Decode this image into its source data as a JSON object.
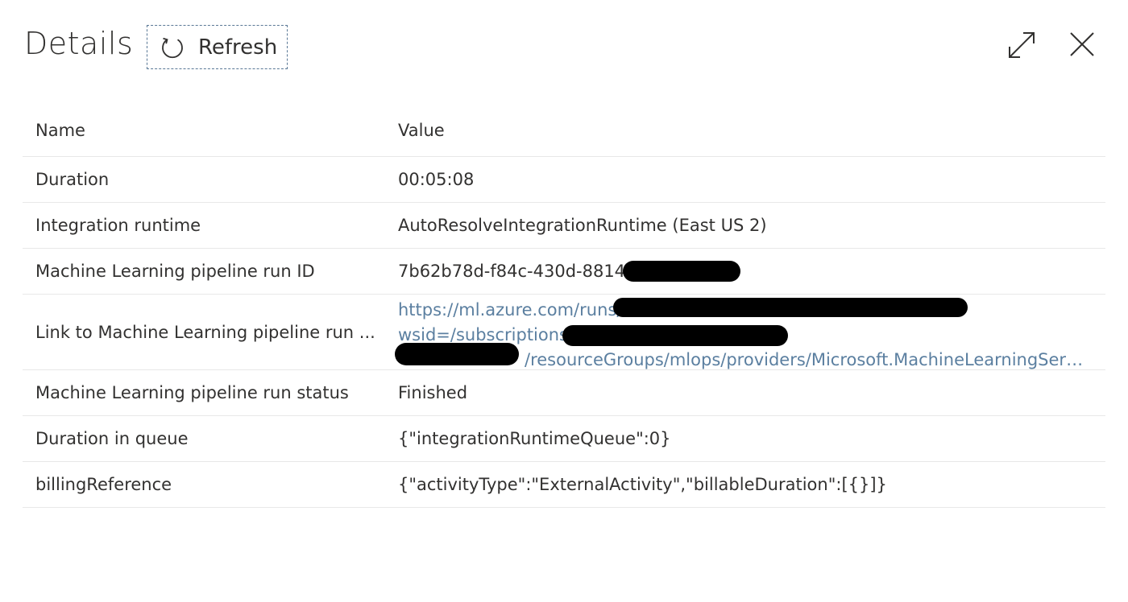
{
  "header": {
    "title": "Details",
    "refresh_label": "Refresh"
  },
  "table": {
    "columns": [
      "Name",
      "Value"
    ],
    "rows": [
      {
        "name": "Duration",
        "value": "00:05:08"
      },
      {
        "name": "Integration runtime",
        "value": "AutoResolveIntegrationRuntime (East US 2)"
      },
      {
        "name": "Machine Learning pipeline run ID",
        "value": "7b62b78d-f84c-430d-8814-"
      },
      {
        "name": "Link to Machine Learning pipeline run ...",
        "link_lines": [
          "https://ml.azure.com/runs/",
          "wsid=/subscriptions",
          "/resourceGroups/mlops/providers/Microsoft.MachineLearningServic..."
        ]
      },
      {
        "name": "Machine Learning pipeline run status",
        "value": "Finished"
      },
      {
        "name": "Duration in queue",
        "value": "{\"integrationRuntimeQueue\":0}"
      },
      {
        "name": "billingReference",
        "value": "{\"activityType\":\"ExternalActivity\",\"billableDuration\":[{}]}"
      }
    ]
  },
  "icons": {
    "refresh": "refresh-icon",
    "expand": "expand-icon",
    "close": "close-icon"
  },
  "colors": {
    "link": "#5b7fa0",
    "focus_border": "#5a7896",
    "redaction": "#000000"
  }
}
